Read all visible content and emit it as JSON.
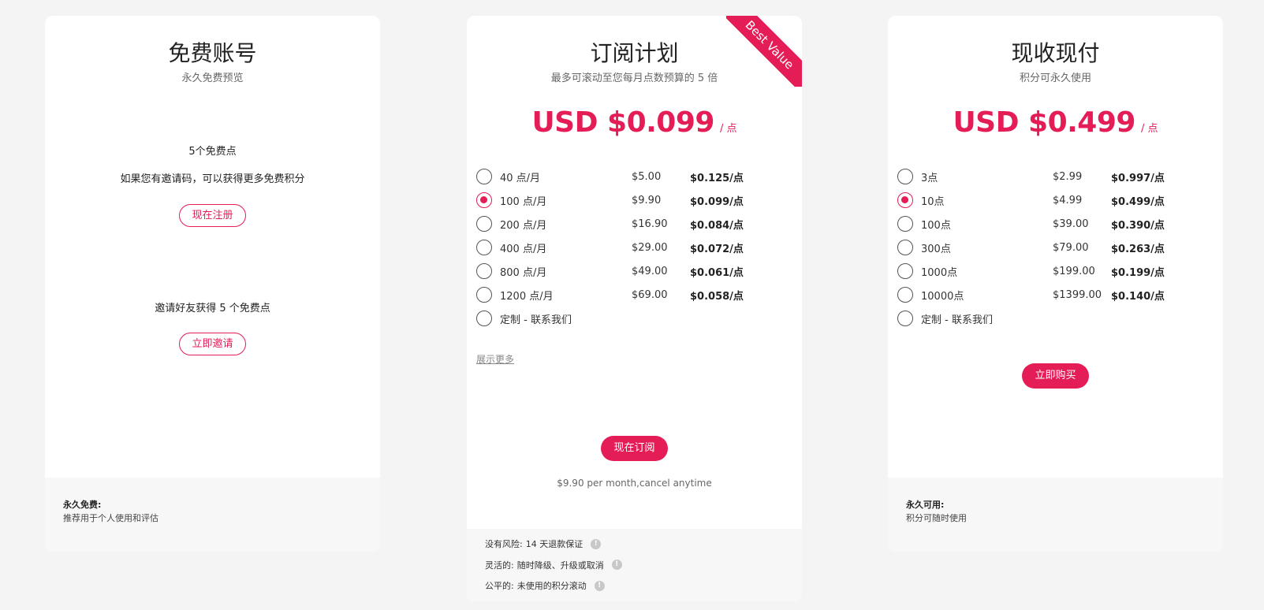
{
  "free": {
    "title": "免费账号",
    "subtitle": "永久免费预览",
    "points_text": "5个免费点",
    "invite_code_text": "如果您有邀请码，可以获得更多免费积分",
    "register_label": "现在注册",
    "invite_friends_text": "邀请好友获得 5 个免费点",
    "invite_label": "立即邀请",
    "footer_title": "永久免费:",
    "footer_text": "推荐用于个人使用和评估"
  },
  "subscription": {
    "ribbon": "Best Value",
    "title": "订阅计划",
    "subtitle": "最多可滚动至您每月点数预算的 5 倍",
    "price": "USD $0.099",
    "price_unit": "/ 点",
    "options": [
      {
        "label": "40 点/月",
        "price": "$5.00",
        "unit_price": "$0.125/点",
        "selected": false
      },
      {
        "label": "100 点/月",
        "price": "$9.90",
        "unit_price": "$0.099/点",
        "selected": true
      },
      {
        "label": "200 点/月",
        "price": "$16.90",
        "unit_price": "$0.084/点",
        "selected": false
      },
      {
        "label": "400 点/月",
        "price": "$29.00",
        "unit_price": "$0.072/点",
        "selected": false
      },
      {
        "label": "800 点/月",
        "price": "$49.00",
        "unit_price": "$0.061/点",
        "selected": false
      },
      {
        "label": "1200 点/月",
        "price": "$69.00",
        "unit_price": "$0.058/点",
        "selected": false
      },
      {
        "label": "定制 - 联系我们",
        "price": "",
        "unit_price": "",
        "selected": false
      }
    ],
    "show_more": "展示更多",
    "subscribe_label": "现在订阅",
    "note": "$9.90 per month,cancel anytime",
    "guarantees": [
      {
        "title": "没有风险:",
        "text": "14 天退款保证"
      },
      {
        "title": "灵活的:",
        "text": "随时降级、升级或取消"
      },
      {
        "title": "公平的:",
        "text": "未使用的积分滚动"
      }
    ]
  },
  "payg": {
    "title": "现收现付",
    "subtitle": "积分可永久使用",
    "price": "USD $0.499",
    "price_unit": "/ 点",
    "options": [
      {
        "label": "3点",
        "price": "$2.99",
        "unit_price": "$0.997/点",
        "selected": false
      },
      {
        "label": "10点",
        "price": "$4.99",
        "unit_price": "$0.499/点",
        "selected": true
      },
      {
        "label": "100点",
        "price": "$39.00",
        "unit_price": "$0.390/点",
        "selected": false
      },
      {
        "label": "300点",
        "price": "$79.00",
        "unit_price": "$0.263/点",
        "selected": false
      },
      {
        "label": "1000点",
        "price": "$199.00",
        "unit_price": "$0.199/点",
        "selected": false
      },
      {
        "label": "10000点",
        "price": "$1399.00",
        "unit_price": "$0.140/点",
        "selected": false
      },
      {
        "label": "定制 - 联系我们",
        "price": "",
        "unit_price": "",
        "selected": false
      }
    ],
    "buy_label": "立即购买",
    "footer_title": "永久可用:",
    "footer_text": "积分可随时使用"
  },
  "colors": {
    "accent": "#e41d57",
    "background": "#f4f4f4",
    "footer_bg": "#f7f7f7"
  },
  "icons": {
    "radio": "radio-icon",
    "info": "info-icon"
  }
}
